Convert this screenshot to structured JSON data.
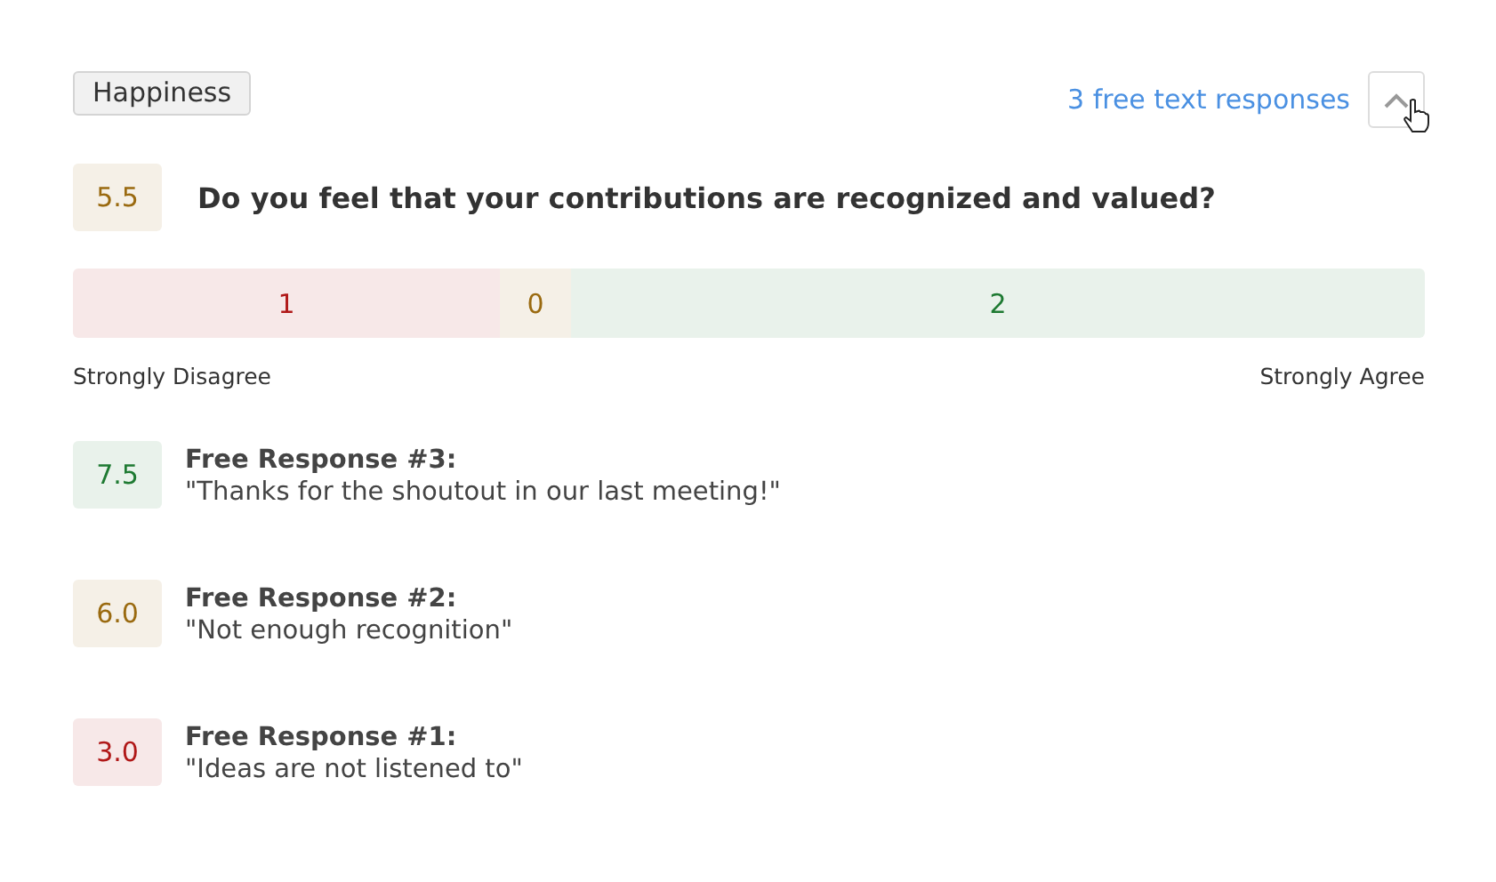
{
  "category": {
    "label": "Happiness"
  },
  "responses_link": {
    "label": "3 free text responses"
  },
  "toggle": {
    "expanded": true
  },
  "question": {
    "score": "5.5",
    "color": "#9a6a10",
    "text": "Do you feel that your contributions are recognized and valued?"
  },
  "distribution": [
    {
      "count": "1",
      "color": "#b01818"
    },
    {
      "count": "0",
      "color": "#9a6a10"
    },
    {
      "count": "2",
      "color": "#1e7a32"
    }
  ],
  "scale": {
    "low_label": "Strongly Disagree",
    "high_label": "Strongly Agree"
  },
  "responses": [
    {
      "score": "7.5",
      "color": "#1e7a32",
      "title": "Free Response #3:",
      "text": "\"Thanks for the shoutout in our last meeting!\""
    },
    {
      "score": "6.0",
      "color": "#9a6a10",
      "title": "Free Response #2:",
      "text": "\"Not enough recognition\""
    },
    {
      "score": "3.0",
      "color": "#b01818",
      "title": "Free Response #1:",
      "text": "\"Ideas are not listened to\""
    }
  ]
}
